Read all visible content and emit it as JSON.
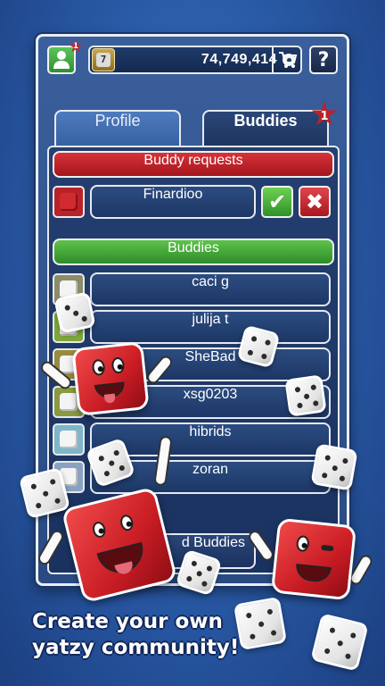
{
  "topbar": {
    "notifications_badge": "1",
    "coins": "74,749,414",
    "help_label": "?"
  },
  "tabs": [
    {
      "label": "Profile"
    },
    {
      "label": "Buddies",
      "badge": "1"
    }
  ],
  "buddy_requests": {
    "title": "Buddy requests",
    "items": [
      {
        "name": "Finardioo"
      }
    ]
  },
  "buddies": {
    "title": "Buddies",
    "items": [
      {
        "name": "caci g"
      },
      {
        "name": "julija t"
      },
      {
        "name": "SheBad"
      },
      {
        "name": "xsg0203"
      },
      {
        "name": "hibrids"
      },
      {
        "name": "zoran"
      }
    ]
  },
  "add_button": {
    "label": "d Buddies"
  },
  "caption": {
    "line1": "Create your own",
    "line2": "yatzy community!"
  },
  "colors": {
    "accent_red": "#c91c24",
    "accent_green": "#2e8b2a",
    "background_blue": "#2858a3"
  }
}
